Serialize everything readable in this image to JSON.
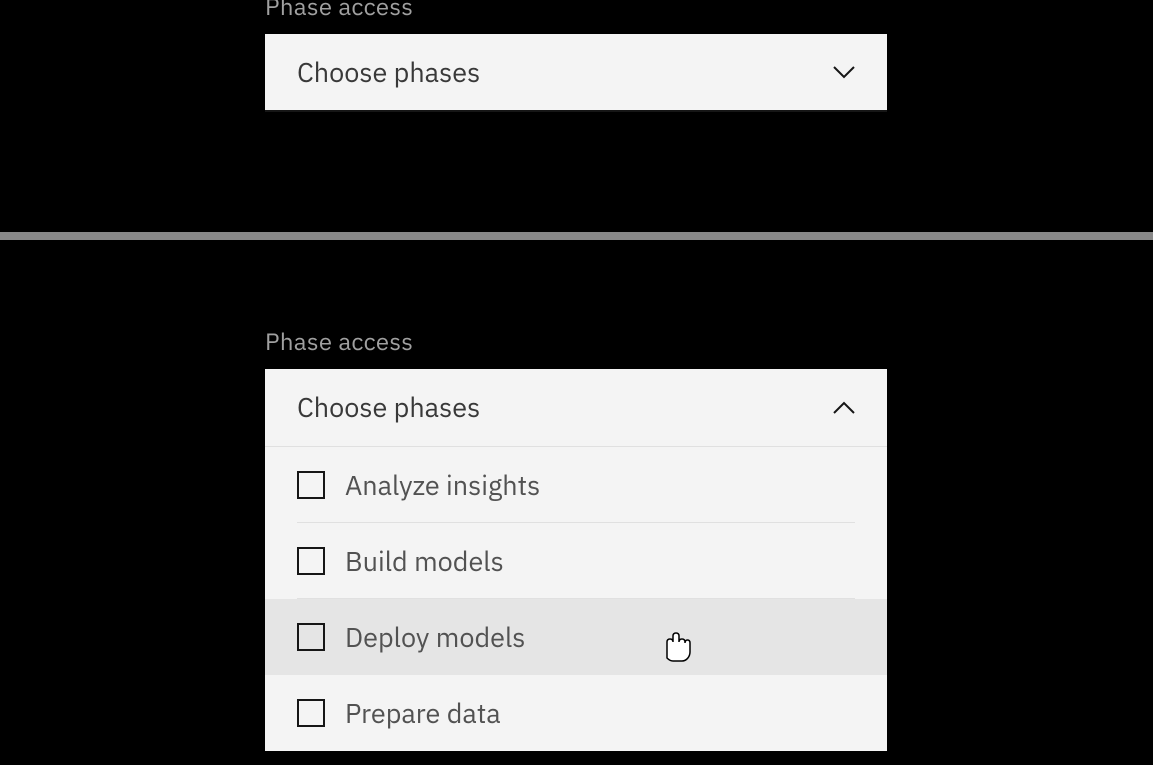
{
  "closed": {
    "label": "Phase access",
    "placeholder": "Choose phases"
  },
  "opened": {
    "label": "Phase access",
    "placeholder": "Choose phases",
    "options": [
      {
        "label": "Analyze insights",
        "checked": false,
        "hover": false
      },
      {
        "label": "Build models",
        "checked": false,
        "hover": false
      },
      {
        "label": "Deploy models",
        "checked": false,
        "hover": true
      },
      {
        "label": "Prepare data",
        "checked": false,
        "hover": false
      }
    ]
  }
}
